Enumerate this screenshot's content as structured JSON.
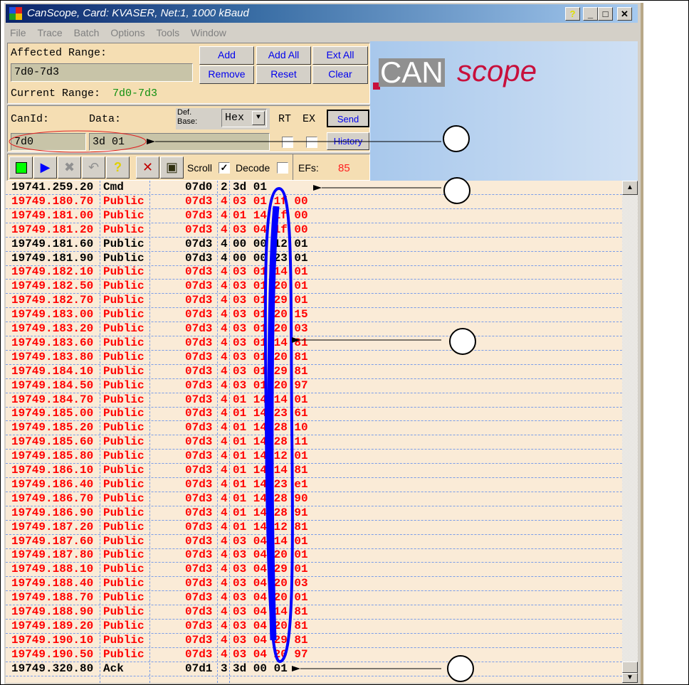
{
  "title": "CanScope, Card: KVASER, Net:1, 1000 kBaud",
  "menu": [
    "File",
    "Trace",
    "Batch",
    "Options",
    "Tools",
    "Window"
  ],
  "range": {
    "affected_label": "Affected Range:",
    "affected_value": "7d0-7d3",
    "current_label": "Current Range:",
    "current_value": "7d0-7d3",
    "buttons": {
      "add": "Add",
      "add_all": "Add All",
      "ext_all": "Ext All",
      "remove": "Remove",
      "reset": "Reset",
      "clear": "Clear"
    }
  },
  "send": {
    "canid_label": "CanId:",
    "data_label": "Data:",
    "def_base_label": "Def. Base:",
    "base_value": "Hex",
    "rt_label": "RT",
    "ex_label": "EX",
    "canid_value": "7d0",
    "data_value": "3d 01",
    "send_button": "Send",
    "history_button": "History"
  },
  "toolbar": {
    "scroll_label": "Scroll",
    "scroll_checked": true,
    "decode_label": "Decode",
    "decode_checked": false,
    "efs_label": "EFs:",
    "efs_value": "85"
  },
  "logo": {
    "text_can": "CAN",
    "text_scope": "scope"
  },
  "colors": {
    "error": "#ff0000",
    "normal": "#000000",
    "annotation": "#0000ff"
  },
  "rows": [
    [
      "19741.259.20",
      "Cmd",
      "07d0",
      "2",
      "3d 01",
      "normal"
    ],
    [
      "19749.180.70",
      "Public",
      "07d3",
      "4",
      "03 01 1f 00",
      "error"
    ],
    [
      "19749.181.00",
      "Public",
      "07d3",
      "4",
      "01 14 1f 00",
      "error"
    ],
    [
      "19749.181.20",
      "Public",
      "07d3",
      "4",
      "03 04 1f 00",
      "error"
    ],
    [
      "19749.181.60",
      "Public",
      "07d3",
      "4",
      "00 00 12 01",
      "normal"
    ],
    [
      "19749.181.90",
      "Public",
      "07d3",
      "4",
      "00 00 23 01",
      "normal"
    ],
    [
      "19749.182.10",
      "Public",
      "07d3",
      "4",
      "03 01 14 01",
      "error"
    ],
    [
      "19749.182.50",
      "Public",
      "07d3",
      "4",
      "03 01 20 01",
      "error"
    ],
    [
      "19749.182.70",
      "Public",
      "07d3",
      "4",
      "03 01 29 01",
      "error"
    ],
    [
      "19749.183.00",
      "Public",
      "07d3",
      "4",
      "03 01 20 15",
      "error"
    ],
    [
      "19749.183.20",
      "Public",
      "07d3",
      "4",
      "03 01 20 03",
      "error"
    ],
    [
      "19749.183.60",
      "Public",
      "07d3",
      "4",
      "03 01 14 81",
      "error"
    ],
    [
      "19749.183.80",
      "Public",
      "07d3",
      "4",
      "03 01 20 81",
      "error"
    ],
    [
      "19749.184.10",
      "Public",
      "07d3",
      "4",
      "03 01 29 81",
      "error"
    ],
    [
      "19749.184.50",
      "Public",
      "07d3",
      "4",
      "03 01 20 97",
      "error"
    ],
    [
      "19749.184.70",
      "Public",
      "07d3",
      "4",
      "01 14 14 01",
      "error"
    ],
    [
      "19749.185.00",
      "Public",
      "07d3",
      "4",
      "01 14 23 61",
      "error"
    ],
    [
      "19749.185.20",
      "Public",
      "07d3",
      "4",
      "01 14 28 10",
      "error"
    ],
    [
      "19749.185.60",
      "Public",
      "07d3",
      "4",
      "01 14 28 11",
      "error"
    ],
    [
      "19749.185.80",
      "Public",
      "07d3",
      "4",
      "01 14 12 01",
      "error"
    ],
    [
      "19749.186.10",
      "Public",
      "07d3",
      "4",
      "01 14 14 81",
      "error"
    ],
    [
      "19749.186.40",
      "Public",
      "07d3",
      "4",
      "01 14 23 e1",
      "error"
    ],
    [
      "19749.186.70",
      "Public",
      "07d3",
      "4",
      "01 14 28 90",
      "error"
    ],
    [
      "19749.186.90",
      "Public",
      "07d3",
      "4",
      "01 14 28 91",
      "error"
    ],
    [
      "19749.187.20",
      "Public",
      "07d3",
      "4",
      "01 14 12 81",
      "error"
    ],
    [
      "19749.187.60",
      "Public",
      "07d3",
      "4",
      "03 04 14 01",
      "error"
    ],
    [
      "19749.187.80",
      "Public",
      "07d3",
      "4",
      "03 04 20 01",
      "error"
    ],
    [
      "19749.188.10",
      "Public",
      "07d3",
      "4",
      "03 04 29 01",
      "error"
    ],
    [
      "19749.188.40",
      "Public",
      "07d3",
      "4",
      "03 04 20 03",
      "error"
    ],
    [
      "19749.188.70",
      "Public",
      "07d3",
      "4",
      "03 04 20 01",
      "error"
    ],
    [
      "19749.188.90",
      "Public",
      "07d3",
      "4",
      "03 04 14 81",
      "error"
    ],
    [
      "19749.189.20",
      "Public",
      "07d3",
      "4",
      "03 04 20 81",
      "error"
    ],
    [
      "19749.190.10",
      "Public",
      "07d3",
      "4",
      "03 04 29 81",
      "error"
    ],
    [
      "19749.190.50",
      "Public",
      "07d3",
      "4",
      "03 04 20 97",
      "error"
    ],
    [
      "19749.320.80",
      "Ack",
      "07d1",
      "3",
      "3d 00 01",
      "normal"
    ]
  ]
}
